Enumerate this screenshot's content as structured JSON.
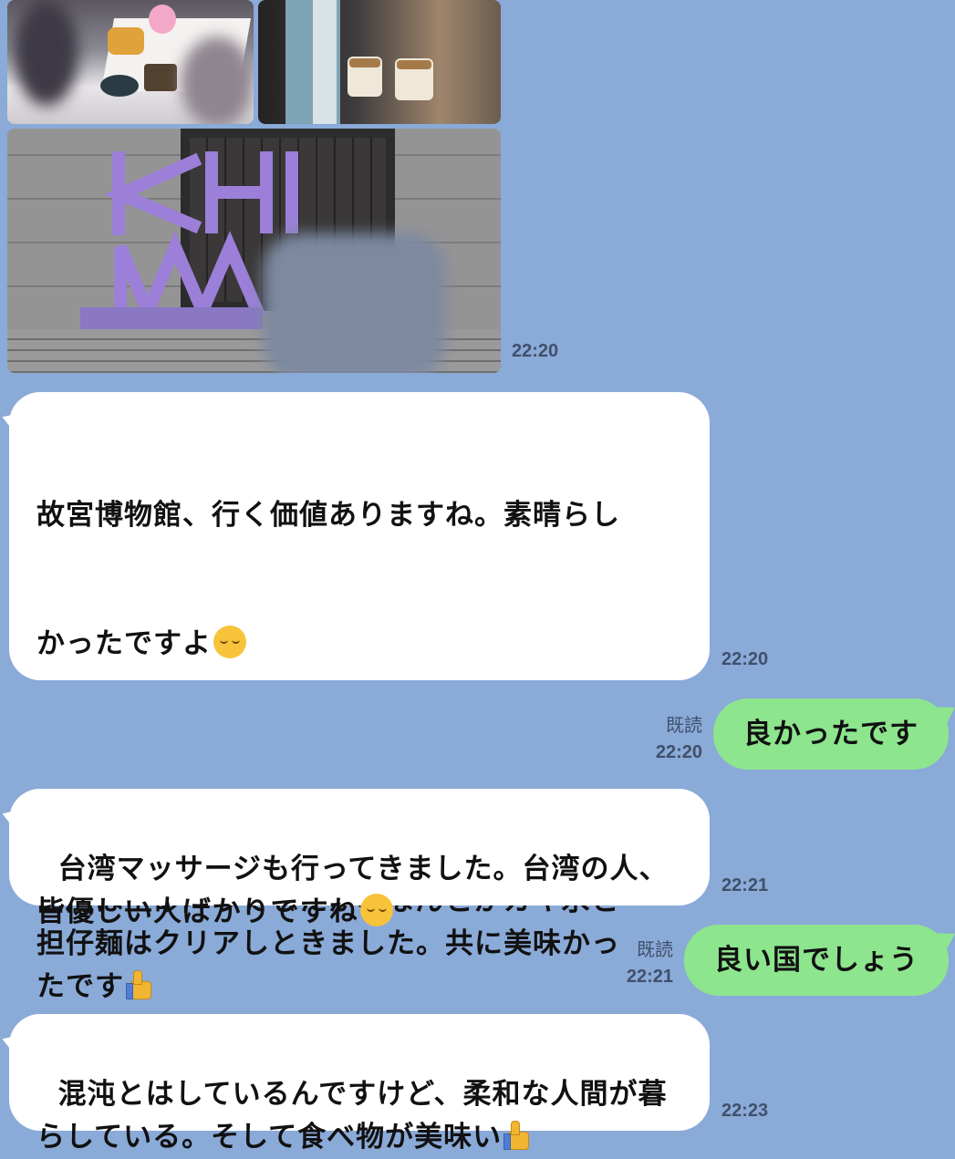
{
  "photos": {
    "top_left_alt": "",
    "top_right_alt": "",
    "sign_letters": "KHI",
    "sent_time": "22:20"
  },
  "messages": [
    {
      "side": "in",
      "lines": [
        "故宮博物館、行く価値ありますね。素晴らし",
        "かったですよ"
      ],
      "emoji": "relieved-face",
      "time": "22:20"
    },
    {
      "side": "in",
      "text": "西門は土砂降りでしたが、なんとかカキ氷と\n担仔麺はクリアしときました。共に美味かっ\nたです",
      "emoji": "thumbs-up",
      "time": "22:20"
    },
    {
      "side": "out",
      "text": "良かったです",
      "read": "既読",
      "time": "22:20"
    },
    {
      "side": "in",
      "text": "台湾マッサージも行ってきました。台湾の人、\n皆優しい人ばかりですね",
      "emoji": "relieved-face",
      "time": "22:21"
    },
    {
      "side": "out",
      "text": "良い国でしょう",
      "read": "既読",
      "time": "22:21"
    },
    {
      "side": "in",
      "text": "混沌とはしているんですけど、柔和な人間が暮\nらしている。そして食べ物が美味い",
      "emoji": "thumbs-up",
      "time": "22:23"
    }
  ],
  "colors": {
    "background": "#8aaad8",
    "incoming_bubble": "#ffffff",
    "outgoing_bubble": "#8de58e"
  }
}
